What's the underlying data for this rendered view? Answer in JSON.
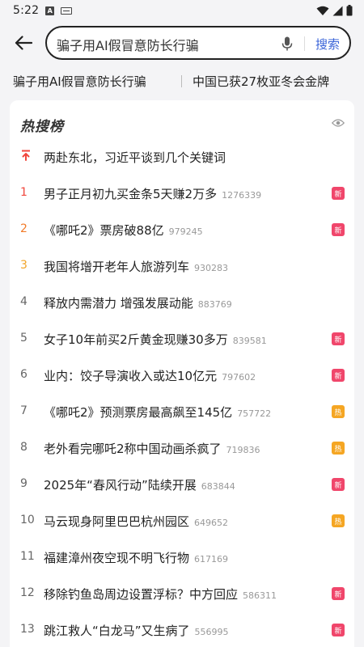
{
  "status_bar": {
    "time": "5:22",
    "notification_letter": "A"
  },
  "search": {
    "query": "骗子用AI假冒意防长行骗",
    "button_label": "搜索"
  },
  "hot_words": [
    "骗子用AI假冒意防长行骗",
    "中国已获27枚亚冬会金牌"
  ],
  "hot_list": {
    "title": "热搜榜",
    "items": [
      {
        "rank": "",
        "title": "两赴东北，习近平谈到几个关键词",
        "count": "",
        "badge": ""
      },
      {
        "rank": "1",
        "title": "男子正月初九买金条5天赚2万多",
        "count": "1276339",
        "badge": "新"
      },
      {
        "rank": "2",
        "title": "《哪吒2》票房破88亿",
        "count": "979245",
        "badge": "新"
      },
      {
        "rank": "3",
        "title": "我国将增开老年人旅游列车",
        "count": "930283",
        "badge": ""
      },
      {
        "rank": "4",
        "title": "释放内需潜力 增强发展动能",
        "count": "883769",
        "badge": ""
      },
      {
        "rank": "5",
        "title": "女子10年前买2斤黄金现赚30多万",
        "count": "839581",
        "badge": "新"
      },
      {
        "rank": "6",
        "title": "业内：饺子导演收入或达10亿元",
        "count": "797602",
        "badge": "新"
      },
      {
        "rank": "7",
        "title": "《哪吒2》预测票房最高飙至145亿",
        "count": "757722",
        "badge": "热"
      },
      {
        "rank": "8",
        "title": "老外看完哪吒2称中国动画杀疯了",
        "count": "719836",
        "badge": "热"
      },
      {
        "rank": "9",
        "title": "2025年“春风行动”陆续开展",
        "count": "683844",
        "badge": "新"
      },
      {
        "rank": "10",
        "title": "马云现身阿里巴巴杭州园区",
        "count": "649652",
        "badge": "热"
      },
      {
        "rank": "11",
        "title": "福建漳州夜空现不明飞行物",
        "count": "617169",
        "badge": ""
      },
      {
        "rank": "12",
        "title": "移除钓鱼岛周边设置浮标？中方回应",
        "count": "586311",
        "badge": "新"
      },
      {
        "rank": "13",
        "title": "跳江救人“白龙马”又生病了",
        "count": "556995",
        "badge": "新"
      }
    ]
  },
  "colors": {
    "accent": "#3a64d8",
    "badge_new": "#f0466b",
    "badge_hot": "#f5a623",
    "rank_1": "#f0463c",
    "rank_2": "#f27a28",
    "rank_3": "#f2a52a"
  }
}
